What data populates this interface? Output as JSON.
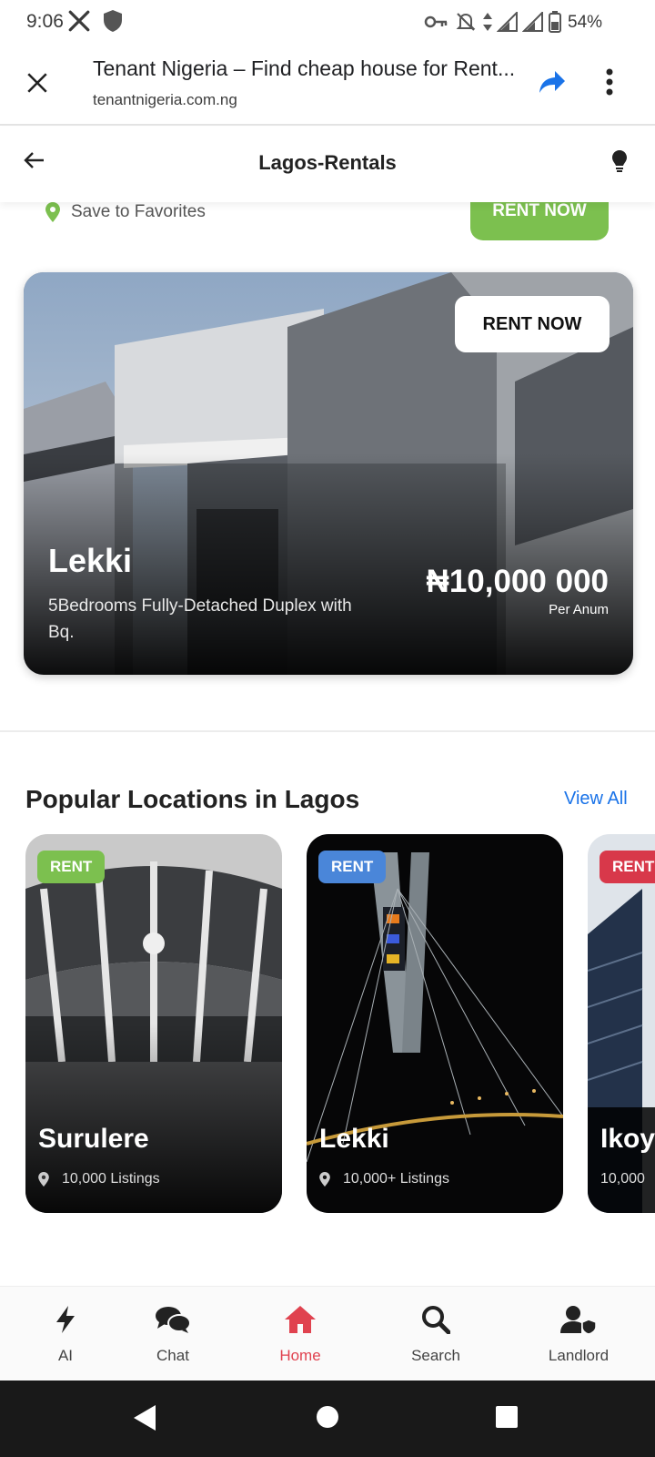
{
  "status_bar": {
    "time": "9:06",
    "battery": "54%",
    "icons": [
      "x-logo-icon",
      "shield-icon",
      "key-icon",
      "bell-off-icon",
      "data-arrows-icon",
      "signal-icon",
      "signal-icon",
      "battery-icon"
    ]
  },
  "browser": {
    "title": "Tenant Nigeria – Find cheap house for Rent...",
    "url": "tenantnigeria.com.ng",
    "icons": [
      "close-icon",
      "share-icon",
      "more-vert-icon"
    ],
    "accent": "#1a73e8"
  },
  "app_bar": {
    "title": "Lagos-Rentals",
    "icons": [
      "back-arrow-icon",
      "lightbulb-icon"
    ]
  },
  "top_strip": {
    "save_label": "Save to Favorites",
    "rent_now_label": "RENT NOW",
    "color": "#7cc04f"
  },
  "hero": {
    "rent_now_label": "RENT NOW",
    "location": "Lekki",
    "description": "5Bedrooms Fully-Detached Duplex with Bq.",
    "price": "₦10,000 000",
    "period": "Per Anum"
  },
  "popular": {
    "title": "Popular Locations in Lagos",
    "view_all": "View All",
    "cards": [
      {
        "badge": "RENT",
        "badge_color": "#7cc04f",
        "name": "Surulere",
        "count": "10,000 Listings"
      },
      {
        "badge": "RENT",
        "badge_color": "#4a86d9",
        "name": "Lekki",
        "count": "10,000+ Listings"
      },
      {
        "badge": "RENT",
        "badge_color": "#d8384a",
        "name": "Ikoyi",
        "count": "10,000"
      }
    ]
  },
  "bottom_nav": {
    "active_color": "#e0424f",
    "items": [
      {
        "label": "AI",
        "icon": "bolt-icon"
      },
      {
        "label": "Chat",
        "icon": "chat-bubbles-icon"
      },
      {
        "label": "Home",
        "icon": "home-icon",
        "active": true
      },
      {
        "label": "Search",
        "icon": "search-icon"
      },
      {
        "label": "Landlord",
        "icon": "user-shield-icon"
      }
    ]
  },
  "system_nav": {
    "icons": [
      "back-triangle-icon",
      "home-circle-icon",
      "recents-square-icon"
    ]
  }
}
